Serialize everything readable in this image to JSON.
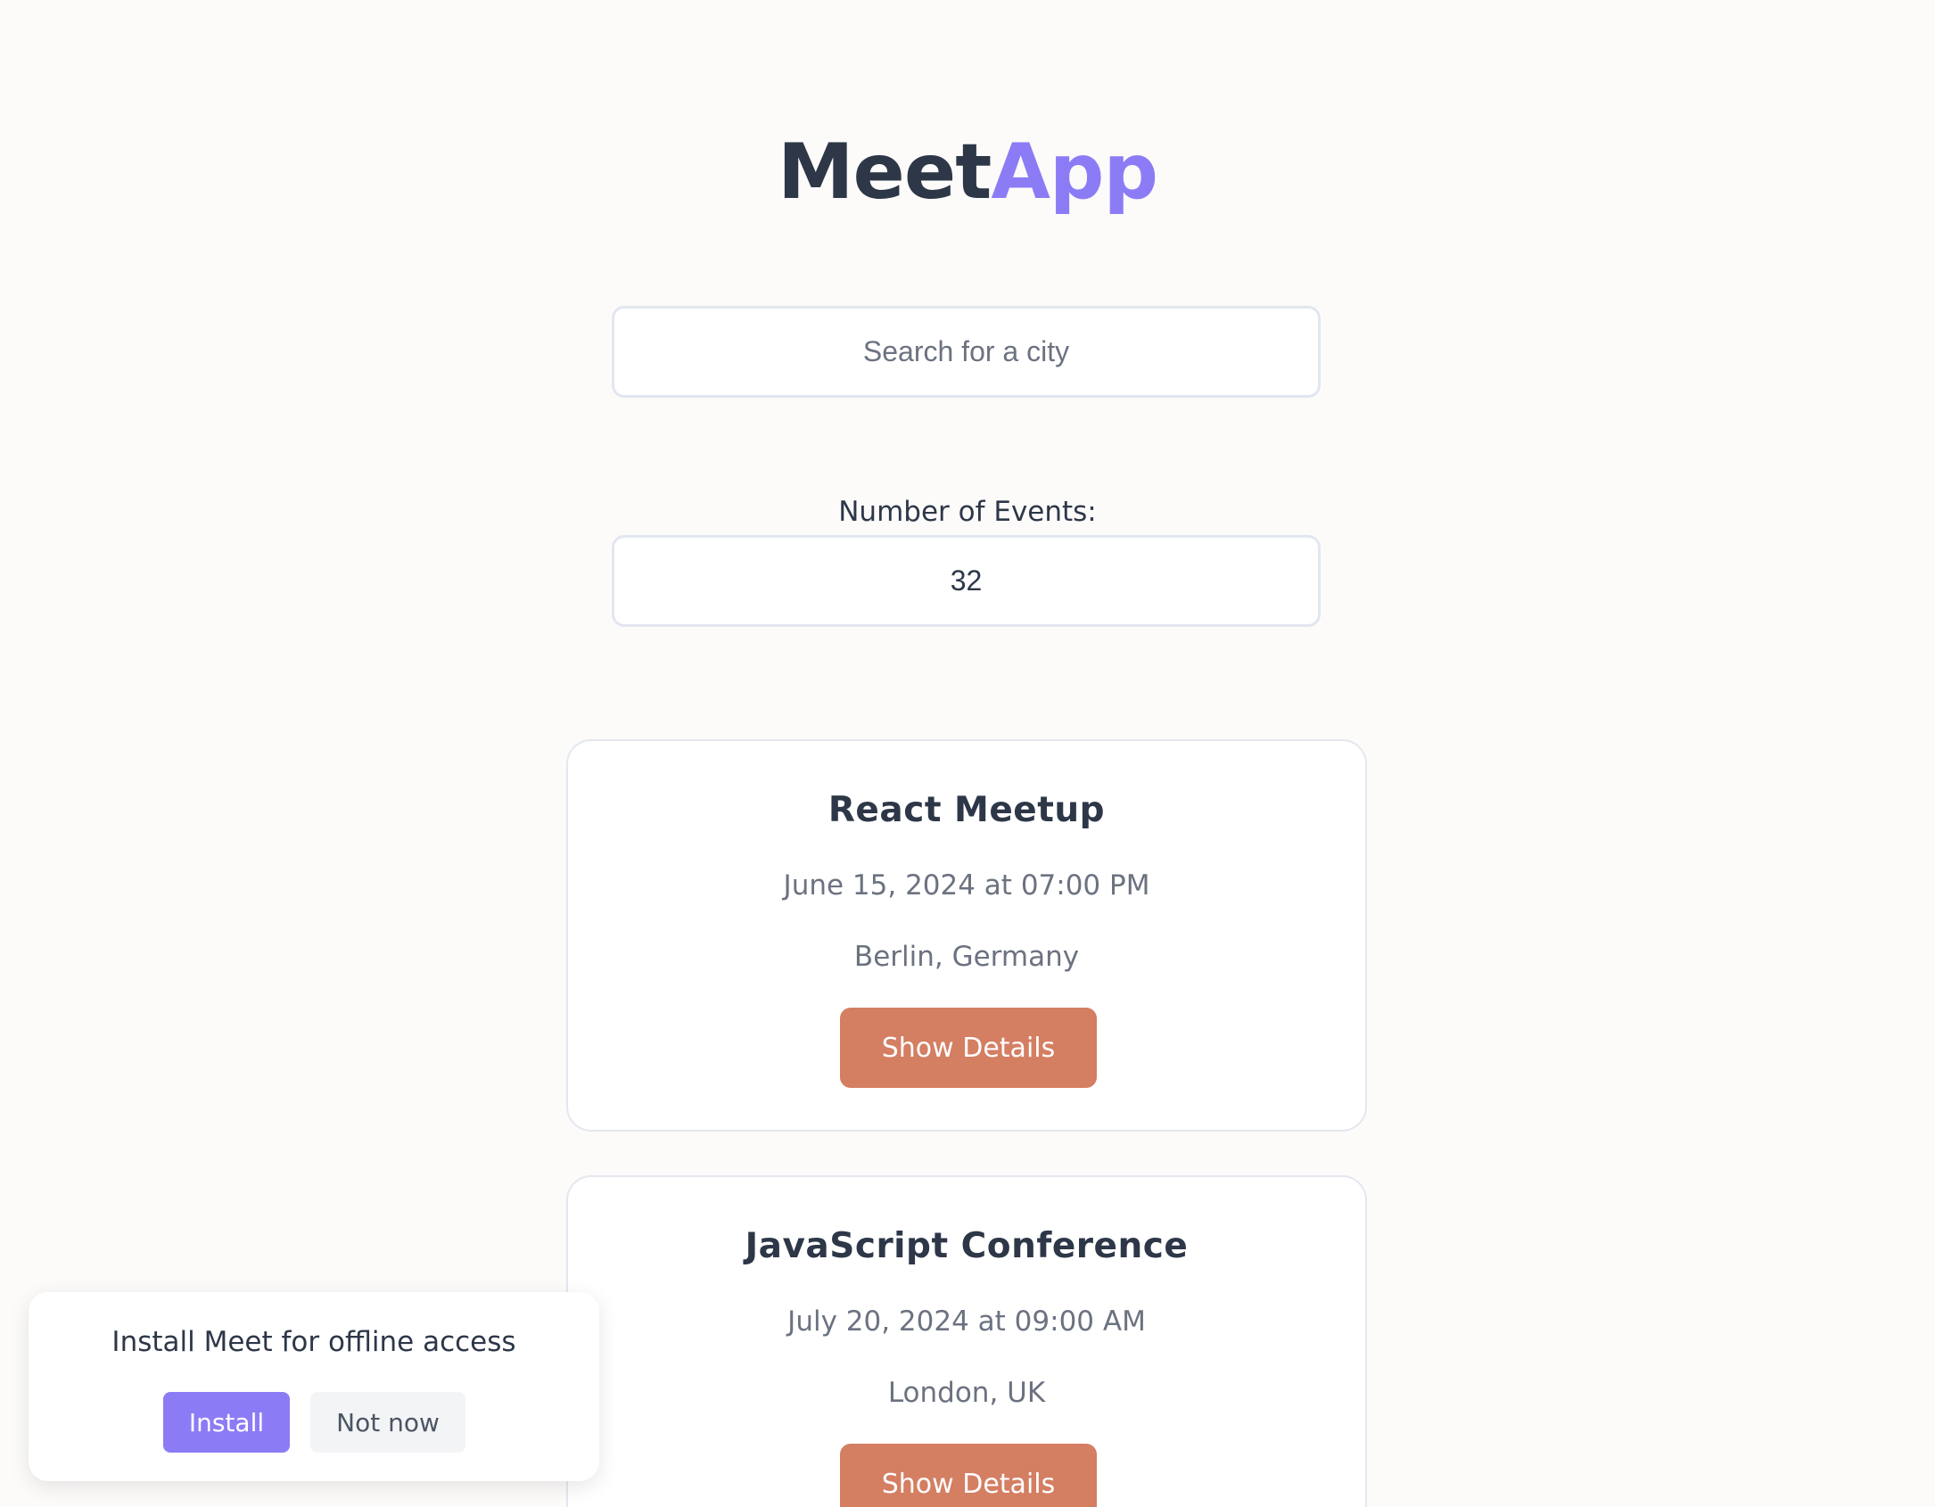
{
  "header": {
    "title_part1": "Meet",
    "title_part2": "App",
    "title_color_primary": "#2d3748",
    "title_color_accent": "#8b7cf6"
  },
  "search": {
    "placeholder": "Search for a city",
    "value": ""
  },
  "number_of_events": {
    "label": "Number of Events:",
    "value": "32"
  },
  "events": [
    {
      "title": "React Meetup",
      "date": "June 15, 2024 at 07:00 PM",
      "location": "Berlin, Germany",
      "button_label": "Show Details"
    },
    {
      "title": "JavaScript Conference",
      "date": "July 20, 2024 at 09:00 AM",
      "location": "London, UK",
      "button_label": "Show Details"
    }
  ],
  "install_prompt": {
    "message": "Install Meet for offline access",
    "install_label": "Install",
    "dismiss_label": "Not now"
  },
  "colors": {
    "background": "#fcfbfa",
    "accent": "#8b7cf6",
    "button": "#d47e62",
    "muted_text": "#6b7280"
  }
}
